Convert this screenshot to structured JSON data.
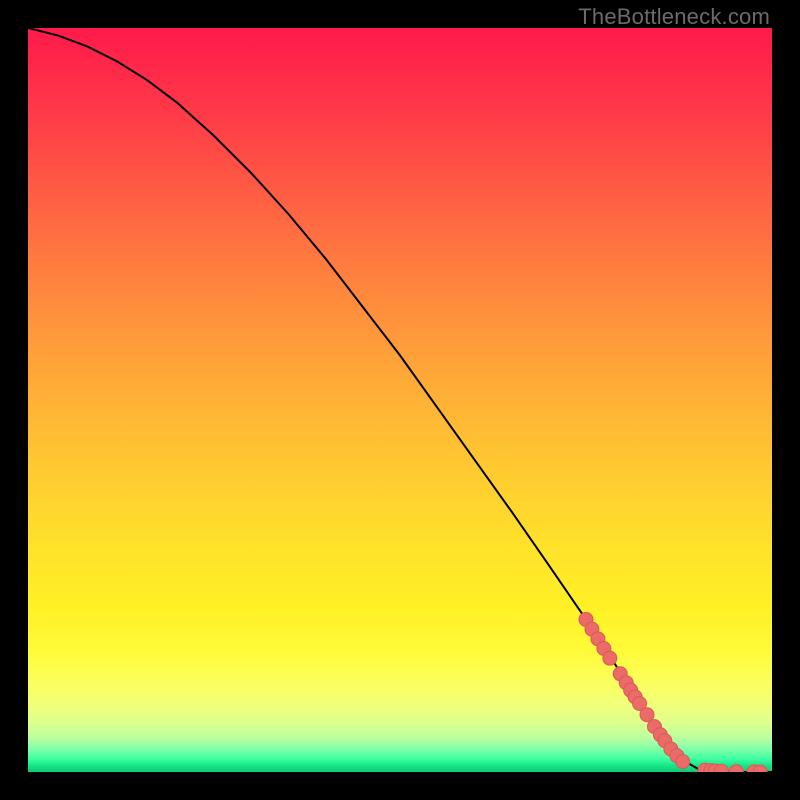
{
  "watermark": "TheBottleneck.com",
  "colors": {
    "marker_fill": "#ec6a67",
    "marker_stroke": "#d85a58",
    "curve": "#000000"
  },
  "chart_data": {
    "type": "line",
    "title": "",
    "xlabel": "",
    "ylabel": "",
    "xlim": [
      0,
      100
    ],
    "ylim": [
      0,
      100
    ],
    "series": [
      {
        "name": "curve",
        "kind": "line",
        "x": [
          0,
          4,
          8,
          12,
          16,
          20,
          25,
          30,
          35,
          40,
          45,
          50,
          55,
          60,
          65,
          70,
          75,
          80,
          82,
          84,
          86,
          88,
          90,
          92,
          94,
          96,
          98,
          100
        ],
        "y": [
          100,
          99,
          97.5,
          95.5,
          93,
          90,
          85.5,
          80.5,
          75,
          69,
          62.5,
          56,
          49,
          42,
          35,
          27.8,
          20.5,
          12.8,
          9.6,
          6.4,
          3.6,
          1.6,
          0.45,
          0.1,
          0.02,
          0.0,
          0.0,
          0.0
        ]
      },
      {
        "name": "markers",
        "kind": "scatter",
        "points": [
          {
            "x": 75.0,
            "y": 20.5
          },
          {
            "x": 75.8,
            "y": 19.2
          },
          {
            "x": 76.6,
            "y": 17.9
          },
          {
            "x": 77.4,
            "y": 16.6
          },
          {
            "x": 78.2,
            "y": 15.3
          },
          {
            "x": 79.6,
            "y": 13.2
          },
          {
            "x": 80.4,
            "y": 12.0
          },
          {
            "x": 81.0,
            "y": 11.0
          },
          {
            "x": 81.6,
            "y": 10.1
          },
          {
            "x": 82.2,
            "y": 9.2
          },
          {
            "x": 83.2,
            "y": 7.7
          },
          {
            "x": 84.2,
            "y": 6.1
          },
          {
            "x": 85.0,
            "y": 5.0
          },
          {
            "x": 85.6,
            "y": 4.2
          },
          {
            "x": 86.4,
            "y": 3.1
          },
          {
            "x": 87.2,
            "y": 2.2
          },
          {
            "x": 88.0,
            "y": 1.4
          },
          {
            "x": 91.0,
            "y": 0.25
          },
          {
            "x": 91.8,
            "y": 0.18
          },
          {
            "x": 92.4,
            "y": 0.14
          },
          {
            "x": 93.2,
            "y": 0.1
          },
          {
            "x": 95.2,
            "y": 0.04
          },
          {
            "x": 97.6,
            "y": 0.01
          },
          {
            "x": 98.4,
            "y": 0.005
          }
        ]
      }
    ]
  }
}
